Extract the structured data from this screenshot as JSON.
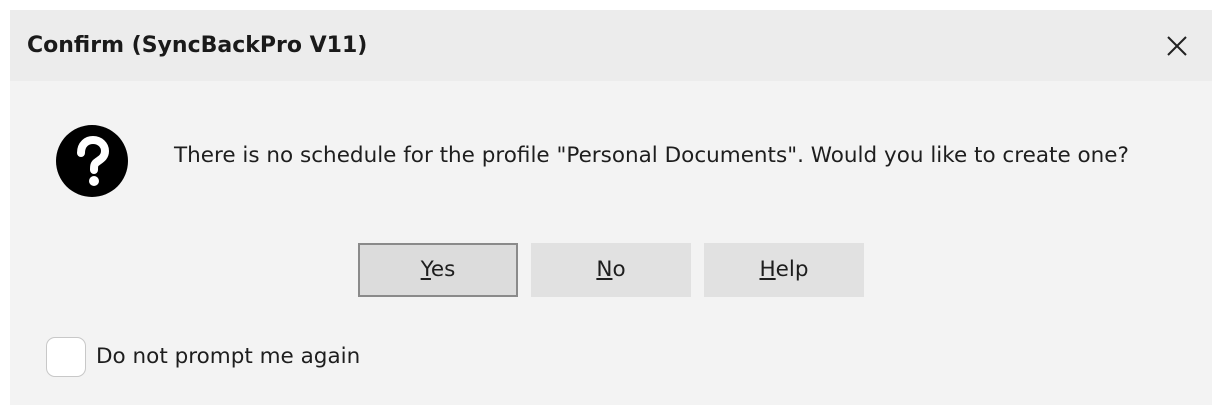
{
  "dialog": {
    "title": "Confirm (SyncBackPro V11)",
    "close_icon": "close-icon",
    "icon": "question-icon",
    "message": "There is no schedule for the profile \"Personal Documents\". Would you like to create one?"
  },
  "buttons": {
    "yes": {
      "mnemonic": "Y",
      "rest": "es",
      "is_default": true
    },
    "no": {
      "mnemonic": "N",
      "rest": "o"
    },
    "help": {
      "mnemonic": "H",
      "rest": "elp"
    }
  },
  "checkbox": {
    "label": "Do not prompt me again",
    "checked": false
  },
  "colors": {
    "titlebar_bg": "#ececec",
    "body_bg": "#f3f3f3",
    "button_bg": "#e1e1e1",
    "default_button_border": "#8a8a8a",
    "icon_fg": "#000000"
  }
}
